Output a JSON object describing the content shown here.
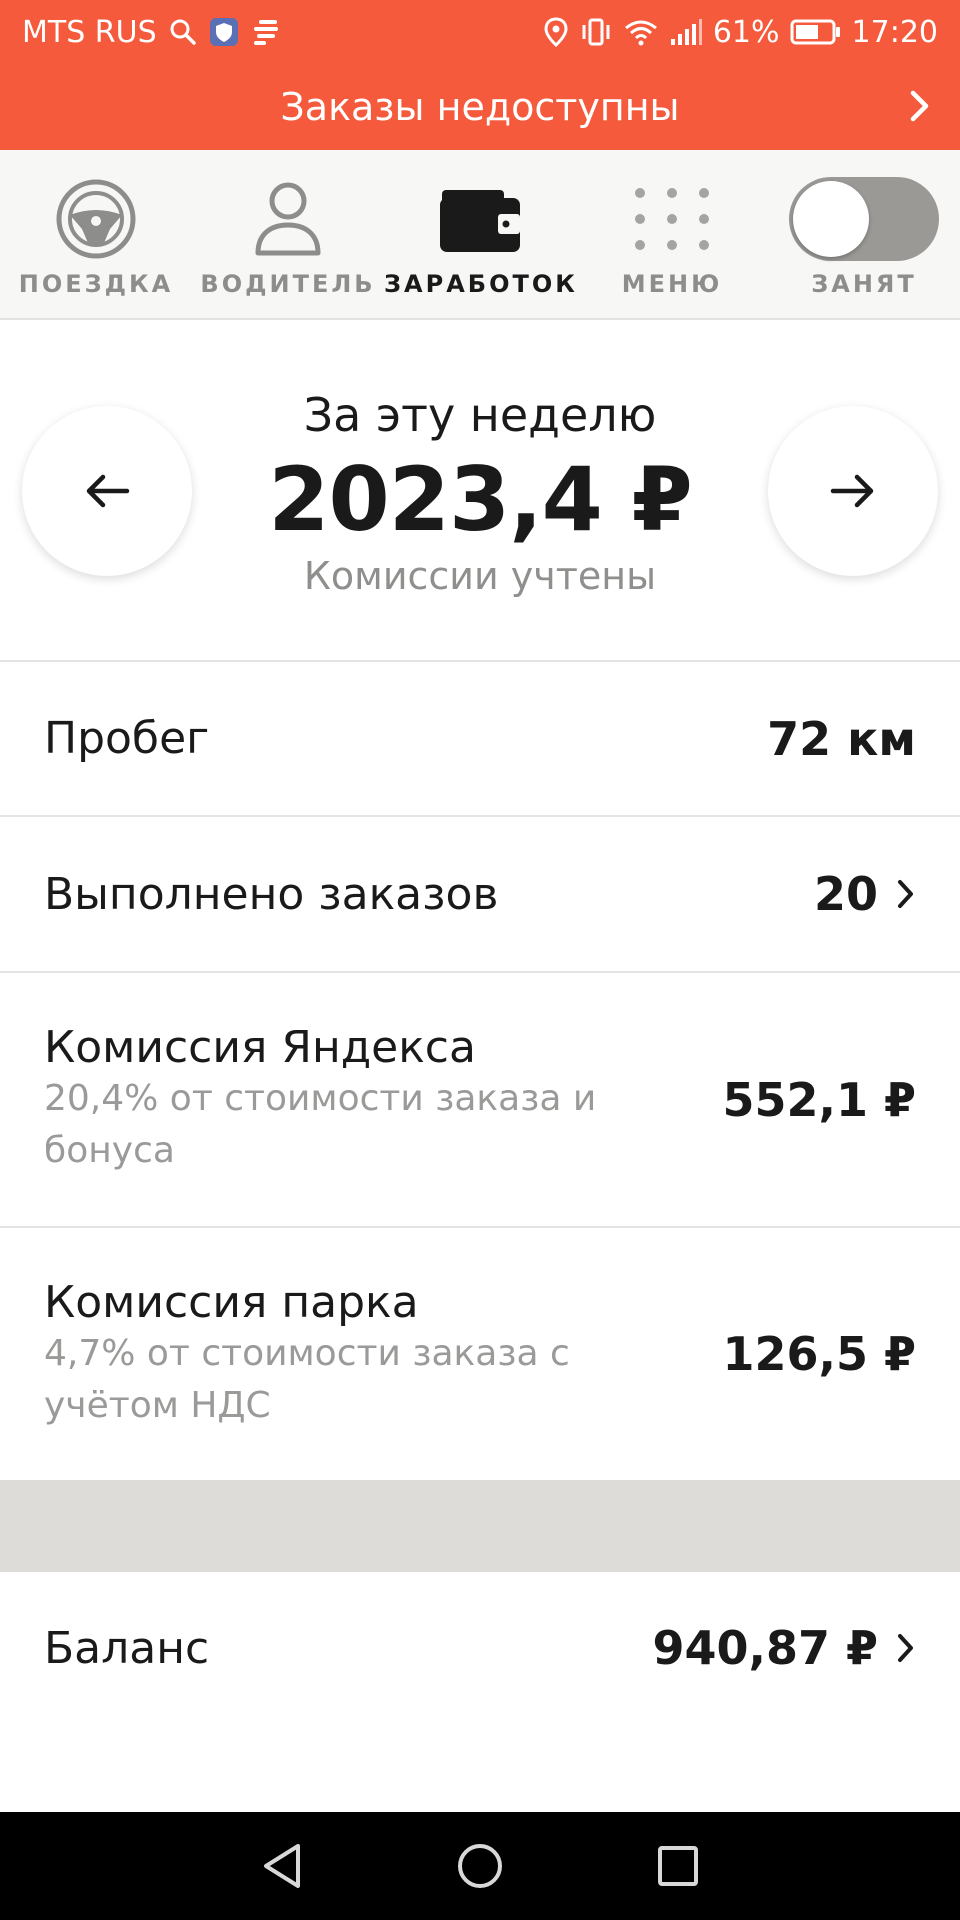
{
  "status_bar": {
    "carrier": "MTS RUS",
    "battery": "61%",
    "time": "17:20"
  },
  "banner": {
    "text": "Заказы недоступны"
  },
  "nav": {
    "items": [
      {
        "label": "ПОЕЗДКА",
        "icon": "steering-wheel-icon"
      },
      {
        "label": "ВОДИТЕЛЬ",
        "icon": "person-icon"
      },
      {
        "label": "ЗАРАБОТОК",
        "icon": "wallet-icon"
      },
      {
        "label": "МЕНЮ",
        "icon": "grid-dots-icon"
      },
      {
        "label": "ЗАНЯТ",
        "icon": "toggle-switch"
      }
    ],
    "active": "ЗАРАБОТОК",
    "busy_toggle_on": false
  },
  "week": {
    "caption": "За эту неделю",
    "total": "2023,4 ₽",
    "note": "Комиссии учтены"
  },
  "rows": {
    "mileage": {
      "label": "Пробег",
      "value": "72 км"
    },
    "orders": {
      "label": "Выполнено заказов",
      "value": "20"
    },
    "yandex_commission": {
      "label": "Комиссия Яндекса",
      "sub": "20,4% от стоимости заказа и бонуса",
      "value": "552,1 ₽"
    },
    "park_commission": {
      "label": "Комиссия парка",
      "sub": "4,7% от стоимости заказа с учётом НДС",
      "value": "126,5 ₽"
    },
    "balance": {
      "label": "Баланс",
      "value": "940,87 ₽"
    }
  },
  "colors": {
    "accent": "#f55a3c",
    "nav_bg": "#f7f7f6",
    "muted_text": "#8f8f8d",
    "divider": "#e4e4e2",
    "band": "#dddcd9"
  }
}
